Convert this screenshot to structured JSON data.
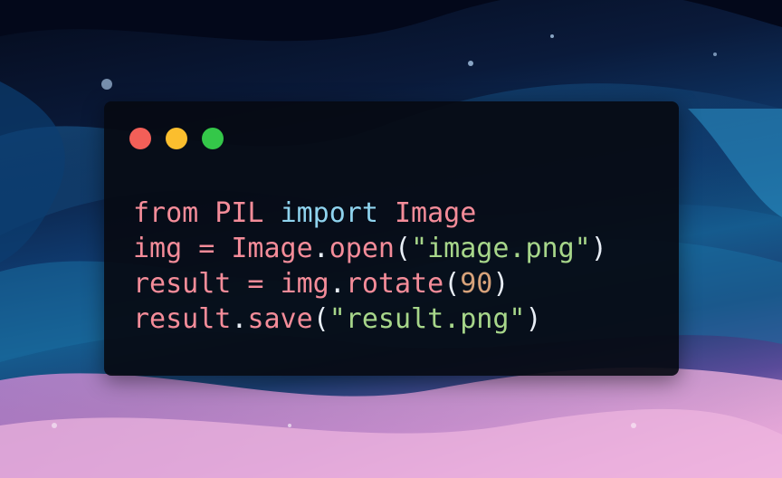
{
  "colors": {
    "close_dot": "#f25f58",
    "minimize_dot": "#fbbe2e",
    "maximize_dot": "#34c749",
    "keyword": "#f48c99",
    "import_keyword": "#8fd3ee",
    "string": "#a7d68a",
    "number": "#d7a27a",
    "punctuation": "#e8eef6",
    "window_background": "#060a12"
  },
  "window_controls": {
    "close": "red-close-dot-icon",
    "minimize": "yellow-minimize-dot-icon",
    "maximize": "green-maximize-dot-icon"
  },
  "code": {
    "line1": {
      "kw_from": "from",
      "sp1": " ",
      "module": "PIL",
      "sp2": " ",
      "kw_import": "import",
      "sp3": " ",
      "name": "Image"
    },
    "line2": {
      "var": "img",
      "op": " = ",
      "obj": "Image",
      "dot": ".",
      "method": "open",
      "lparen": "(",
      "str": "\"image.png\"",
      "rparen": ")"
    },
    "line3": {
      "var": "result",
      "op": " = ",
      "obj": "img",
      "dot": ".",
      "method": "rotate",
      "lparen": "(",
      "num": "90",
      "rparen": ")"
    },
    "line4": {
      "obj": "result",
      "dot": ".",
      "method": "save",
      "lparen": "(",
      "str": "\"result.png\"",
      "rparen": ")"
    }
  }
}
